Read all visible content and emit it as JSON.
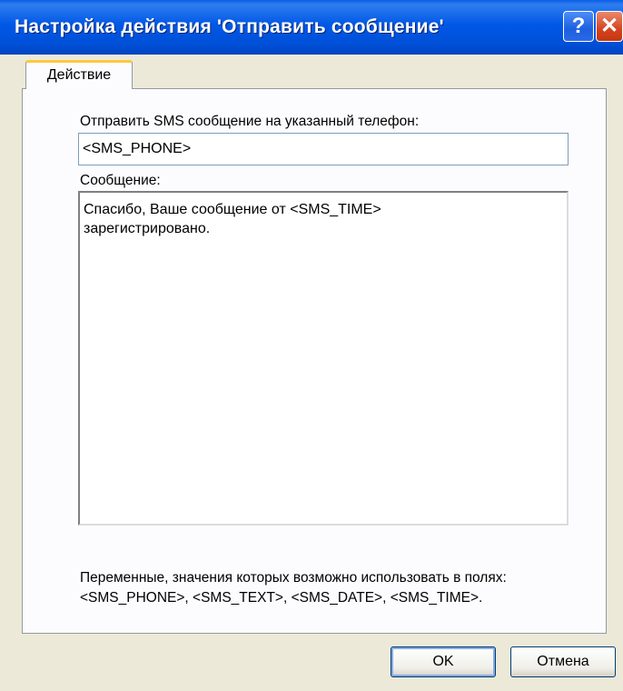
{
  "window": {
    "title": "Настройка действия 'Отправить сообщение'",
    "help_button": "?",
    "close_button": "✕"
  },
  "tabs": [
    {
      "label": "Действие",
      "active": true
    }
  ],
  "phone": {
    "label": "Отправить SMS сообщение на указанный телефон:",
    "value": "<SMS_PHONE>"
  },
  "message": {
    "label": "Сообщение:",
    "value": "Спасибо, Ваше сообщение от <SMS_TIME>\nзарегистрировано."
  },
  "hint": {
    "line1": "Переменные, значения которых возможно использовать в полях:",
    "line2": "<SMS_PHONE>, <SMS_TEXT>, <SMS_DATE>, <SMS_TIME>."
  },
  "buttons": {
    "ok": "OK",
    "cancel": "Отмена"
  },
  "colors": {
    "titlebar": "#0058e6",
    "dialog_bg": "#ece9d8",
    "tab_highlight": "#ffc83c"
  }
}
